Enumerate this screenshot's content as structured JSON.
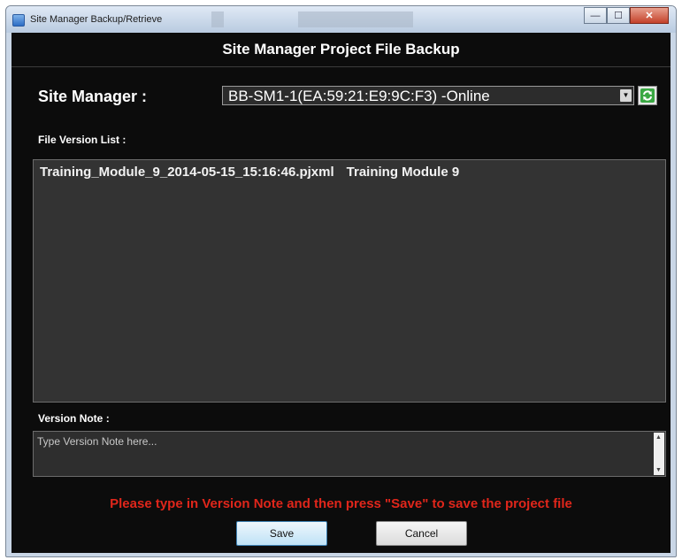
{
  "window": {
    "title": "Site Manager Backup/Retrieve",
    "minimize_glyph": "—",
    "maximize_glyph": "☐",
    "close_glyph": "✕"
  },
  "header": {
    "title": "Site Manager Project File Backup"
  },
  "site_manager": {
    "label": "Site Manager :",
    "selected": "BB-SM1-1(EA:59:21:E9:9C:F3) -Online",
    "refresh_icon": "refresh-icon"
  },
  "file_version_list": {
    "label": "File Version List :",
    "items": [
      {
        "file": "Training_Module_9_2014-05-15_15:16:46.pjxml",
        "description": "Training Module 9"
      }
    ]
  },
  "version_note": {
    "label": "Version Note :",
    "placeholder": "Type Version Note here..."
  },
  "instruction": "Please type in Version Note and then press \"Save\" to save the project file",
  "buttons": {
    "save": "Save",
    "cancel": "Cancel"
  },
  "colors": {
    "instruction": "#e0261b",
    "background": "#0c0c0c",
    "list_bg": "#333333"
  }
}
